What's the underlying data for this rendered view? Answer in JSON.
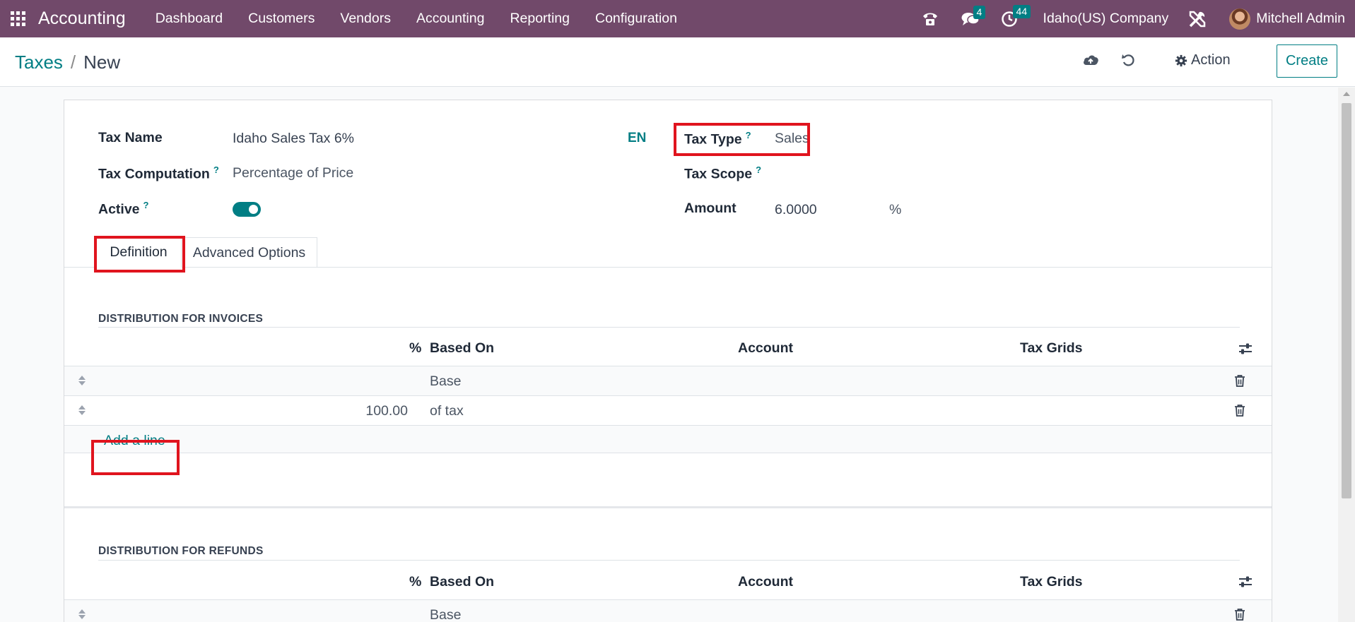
{
  "navbar": {
    "app_name": "Accounting",
    "menu": [
      "Dashboard",
      "Customers",
      "Vendors",
      "Accounting",
      "Reporting",
      "Configuration"
    ],
    "messages_count": "4",
    "activities_count": "44",
    "company": "Idaho(US) Company",
    "user": "Mitchell Admin"
  },
  "control": {
    "breadcrumb_parent": "Taxes",
    "breadcrumb_separator": "/",
    "breadcrumb_current": "New",
    "action_label": "Action",
    "create_label": "Create"
  },
  "form": {
    "tax_name_label": "Tax Name",
    "tax_name_value": "Idaho Sales Tax 6%",
    "lang": "EN",
    "tax_computation_label": "Tax Computation",
    "tax_computation_value": "Percentage of Price",
    "active_label": "Active",
    "active_value": true,
    "tax_type_label": "Tax Type",
    "tax_type_value": "Sales",
    "tax_scope_label": "Tax Scope",
    "tax_scope_value": "",
    "amount_label": "Amount",
    "amount_value": "6.0000",
    "amount_unit": "%",
    "help_marker": "?"
  },
  "tabs": {
    "definition": "Definition",
    "advanced": "Advanced Options"
  },
  "columns": {
    "percent": "%",
    "based_on": "Based On",
    "account": "Account",
    "tax_grids": "Tax Grids"
  },
  "invoices": {
    "title": "DISTRIBUTION FOR INVOICES",
    "rows": [
      {
        "percent": "",
        "based_on": "Base",
        "account": "",
        "tax_grids": ""
      },
      {
        "percent": "100.00",
        "based_on": "of tax",
        "account": "",
        "tax_grids": ""
      }
    ],
    "add_line": "Add a line"
  },
  "refunds": {
    "title": "DISTRIBUTION FOR REFUNDS",
    "rows": [
      {
        "percent": "",
        "based_on": "Base",
        "account": "",
        "tax_grids": ""
      }
    ]
  },
  "colors": {
    "navbar": "#71496a",
    "accent": "#017e84",
    "highlight": "#e0141e"
  }
}
